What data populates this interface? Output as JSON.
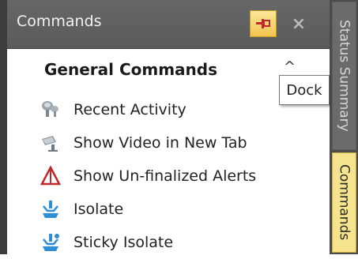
{
  "panel": {
    "title": "Commands",
    "pin_icon": "pin-icon",
    "close_label": "×"
  },
  "tooltip": {
    "text": "Dock"
  },
  "section": {
    "title": "General Commands",
    "collapse_glyph": "^"
  },
  "commands": [
    {
      "label": "Recent Activity",
      "icon": "recent-activity-icon"
    },
    {
      "label": "Show Video in New Tab",
      "icon": "camera-icon"
    },
    {
      "label": "Show Un-finalized Alerts",
      "icon": "alert-triangle-icon"
    },
    {
      "label": "Isolate",
      "icon": "isolate-icon"
    },
    {
      "label": "Sticky Isolate",
      "icon": "sticky-isolate-icon"
    }
  ],
  "side_tabs": [
    {
      "label": "Status Summary",
      "active": false
    },
    {
      "label": "Commands",
      "active": true
    }
  ],
  "colors": {
    "header_bg": "#5e5e5e",
    "accent_active": "#f6e38e",
    "alert_red": "#c0282d",
    "isolate_blue": "#2f8fd6"
  }
}
